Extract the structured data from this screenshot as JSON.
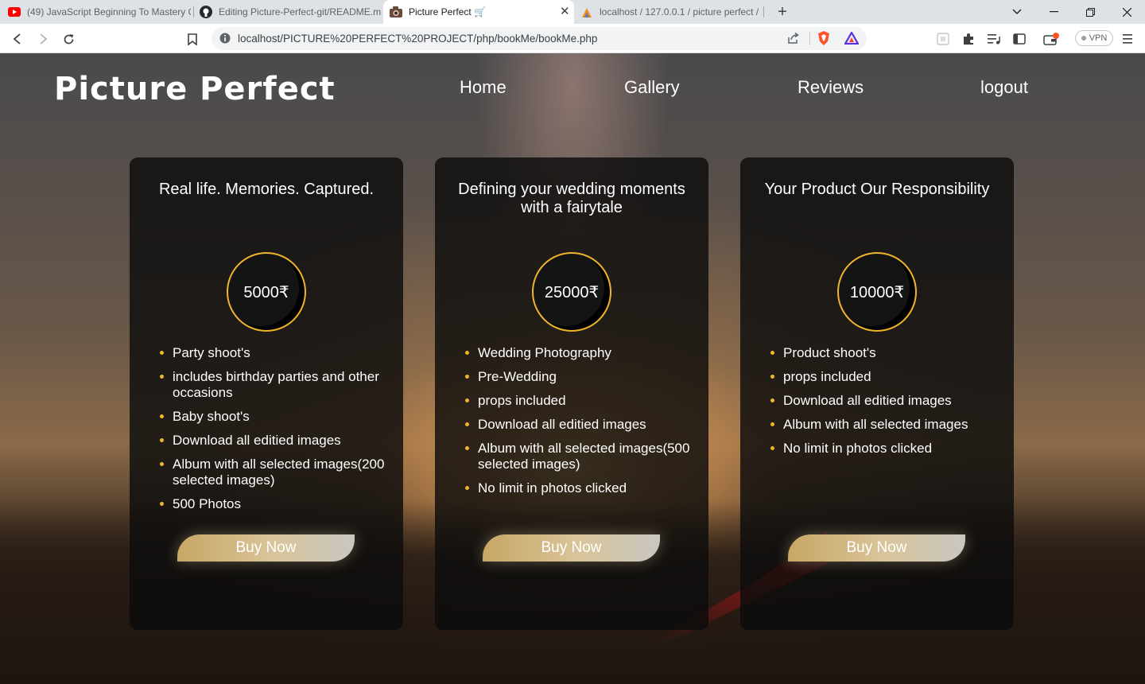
{
  "browser": {
    "tabs": [
      {
        "title": "(49) JavaScript Beginning To Mastery C",
        "icon": "youtube-icon"
      },
      {
        "title": "Editing Picture-Perfect-git/README.m",
        "icon": "github-icon"
      },
      {
        "title": "Picture Perfect 🛒",
        "icon": "camera-icon",
        "active": true
      },
      {
        "title": "localhost / 127.0.0.1 / picture perfect /",
        "icon": "phpmyadmin-icon"
      }
    ],
    "url": "localhost/PICTURE%20PERFECT%20PROJECT/php/bookMe/bookMe.php",
    "vpn_label": "VPN"
  },
  "site": {
    "logo": "Picture Perfect",
    "nav": [
      "Home",
      "Gallery",
      "Reviews",
      "logout"
    ]
  },
  "plans": [
    {
      "title": "Real life. Memories. Captured.",
      "price": "5000₹",
      "features": [
        "Party shoot's",
        "includes birthday parties and other occasions",
        "Baby shoot's",
        "Download all editied images",
        "Album with all selected images(200 selected images)",
        "500 Photos"
      ],
      "button": "Buy Now"
    },
    {
      "title": "Defining your wedding moments with a fairytale",
      "price": "25000₹",
      "features": [
        "Wedding Photography",
        "Pre-Wedding",
        "props included",
        "Download all editied images",
        "Album with all selected images(500 selected images)",
        "No limit in photos clicked"
      ],
      "button": "Buy Now"
    },
    {
      "title": "Your Product Our Responsibility",
      "price": "10000₹",
      "features": [
        "Product shoot's",
        "props included",
        "Download all editied images",
        "Album with all selected images",
        "No limit in photos clicked"
      ],
      "button": "Buy Now"
    }
  ],
  "colors": {
    "accent": "#f0b52c",
    "card_bg": "#0c0c0c"
  }
}
